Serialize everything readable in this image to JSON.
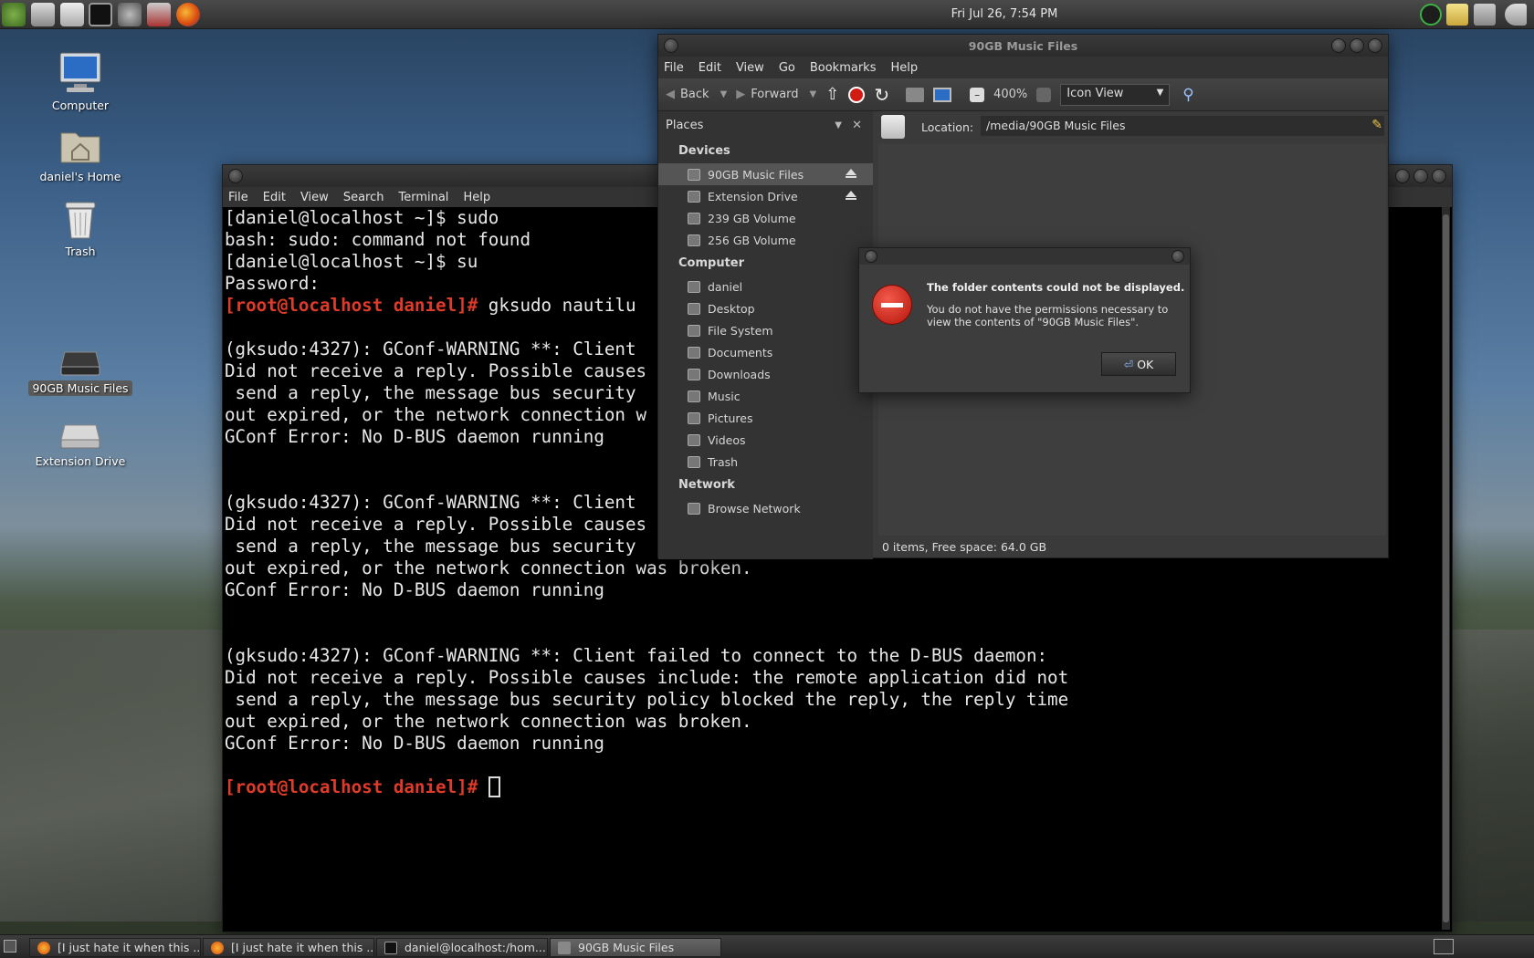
{
  "panel": {
    "clock": "Fri Jul 26,  7:54 PM",
    "launchers": [
      "play-icon",
      "camera-icon",
      "files-icon",
      "terminal-icon",
      "settings-icon",
      "package-icon",
      "firefox-icon"
    ],
    "tray": [
      "check-icon",
      "notes-icon",
      "clipboard-icon",
      "volume-icon"
    ]
  },
  "desktop": {
    "icons": [
      {
        "label": "Computer",
        "icon": "computer-icon"
      },
      {
        "label": "daniel's Home",
        "icon": "home-folder-icon"
      },
      {
        "label": "Trash",
        "icon": "trash-icon"
      },
      {
        "label": "90GB Music Files",
        "icon": "drive-icon"
      },
      {
        "label": "Extension Drive",
        "icon": "drive-icon"
      }
    ]
  },
  "terminal": {
    "menu": [
      "File",
      "Edit",
      "View",
      "Search",
      "Terminal",
      "Help"
    ],
    "lines": [
      "[daniel@localhost ~]$ sudo",
      "bash: sudo: command not found",
      "[daniel@localhost ~]$ su",
      "Password:",
      "gksudo nautilu",
      "",
      "(gksudo:4327): GConf-WARNING **: Client",
      "Did not receive a reply. Possible causes",
      " send a reply, the message bus security",
      "out expired, or the network connection w",
      "GConf Error: No D-BUS daemon running",
      "",
      "",
      "(gksudo:4327): GConf-WARNING **: Client",
      "Did not receive a reply. Possible causes",
      " send a reply, the message bus security",
      "out expired, or the network connection was broken.",
      "GConf Error: No D-BUS daemon running",
      "",
      "",
      "(gksudo:4327): GConf-WARNING **: Client failed to connect to the D-BUS daemon:",
      "Did not receive a reply. Possible causes include: the remote application did not",
      " send a reply, the message bus security policy blocked the reply, the reply time",
      "out expired, or the network connection was broken.",
      "GConf Error: No D-BUS daemon running",
      ""
    ],
    "root_prompt": "[root@localhost daniel]# "
  },
  "filemanager": {
    "title": "90GB Music Files",
    "menu": [
      "File",
      "Edit",
      "View",
      "Go",
      "Bookmarks",
      "Help"
    ],
    "toolbar": {
      "back": "Back",
      "forward": "Forward",
      "zoom": "400%",
      "view_mode": "Icon View"
    },
    "places_label": "Places",
    "location_label": "Location:",
    "location_value": "/media/90GB Music Files",
    "sections": [
      {
        "name": "Devices",
        "items": [
          "90GB Music Files",
          "Extension Drive",
          "239 GB Volume",
          "256 GB Volume"
        ]
      },
      {
        "name": "Computer",
        "items": [
          "daniel",
          "Desktop",
          "File System",
          "Documents",
          "Downloads",
          "Music",
          "Pictures",
          "Videos",
          "Trash"
        ]
      },
      {
        "name": "Network",
        "items": [
          "Browse Network"
        ]
      }
    ],
    "status": "0 items, Free space: 64.0 GB"
  },
  "dialog": {
    "title": "The folder contents could not be displayed.",
    "message": "You do not have the permissions necessary to view the contents of \"90GB Music Files\".",
    "ok": "OK"
  },
  "taskbar": [
    {
      "label": "[I just hate it when this ...",
      "icon": "firefox-icon"
    },
    {
      "label": "[I just hate it when this ...",
      "icon": "firefox-icon"
    },
    {
      "label": "daniel@localhost:/hom...",
      "icon": "terminal-icon"
    },
    {
      "label": "90GB Music Files",
      "icon": "folder-icon"
    }
  ],
  "colors": {
    "prompt": "#e03a2a",
    "error": "#d62a1c",
    "panel": "#3a3a3a"
  }
}
